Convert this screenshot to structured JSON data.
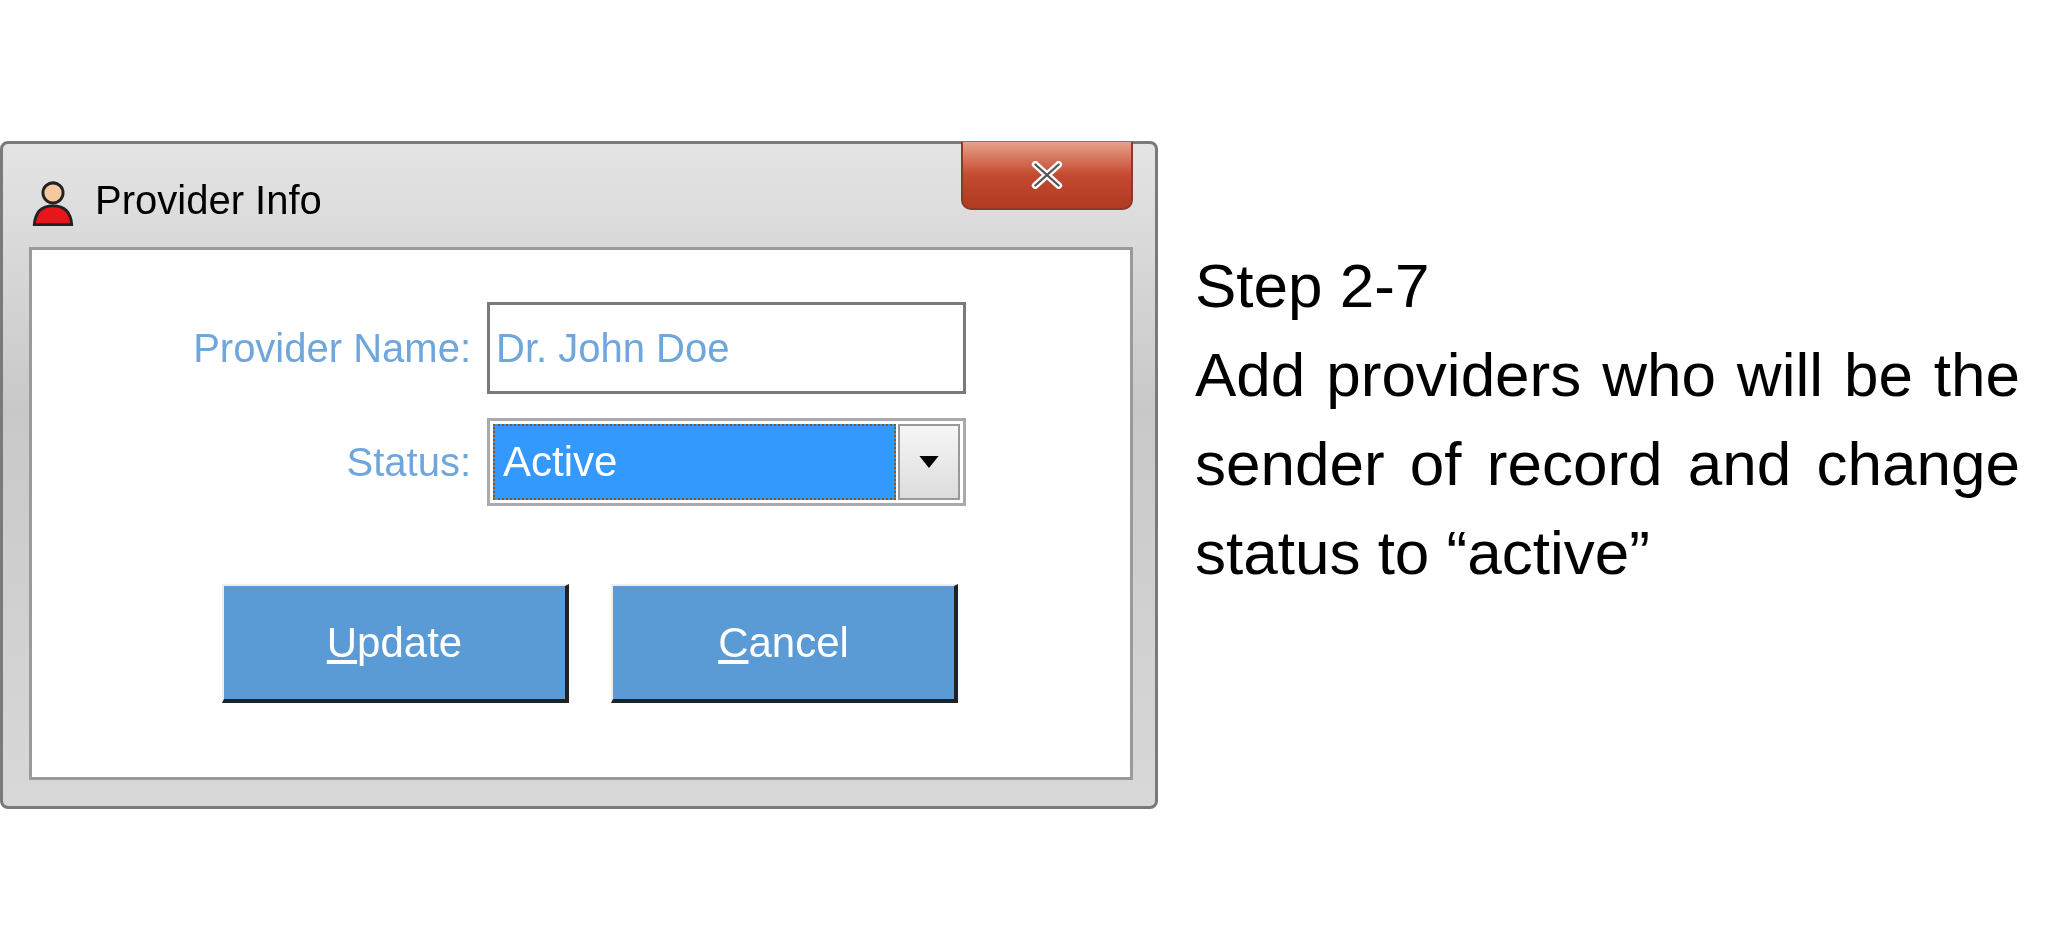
{
  "window": {
    "title": "Provider Info"
  },
  "form": {
    "provider_name": {
      "label": "Provider Name:",
      "value": "Dr. John Doe"
    },
    "status": {
      "label": "Status:",
      "value": "Active"
    }
  },
  "buttons": [
    "Update",
    "Cancel"
  ],
  "caption": {
    "step": "Step 2-7",
    "text": "Add providers who will be the sender of record and change status to “active”"
  }
}
